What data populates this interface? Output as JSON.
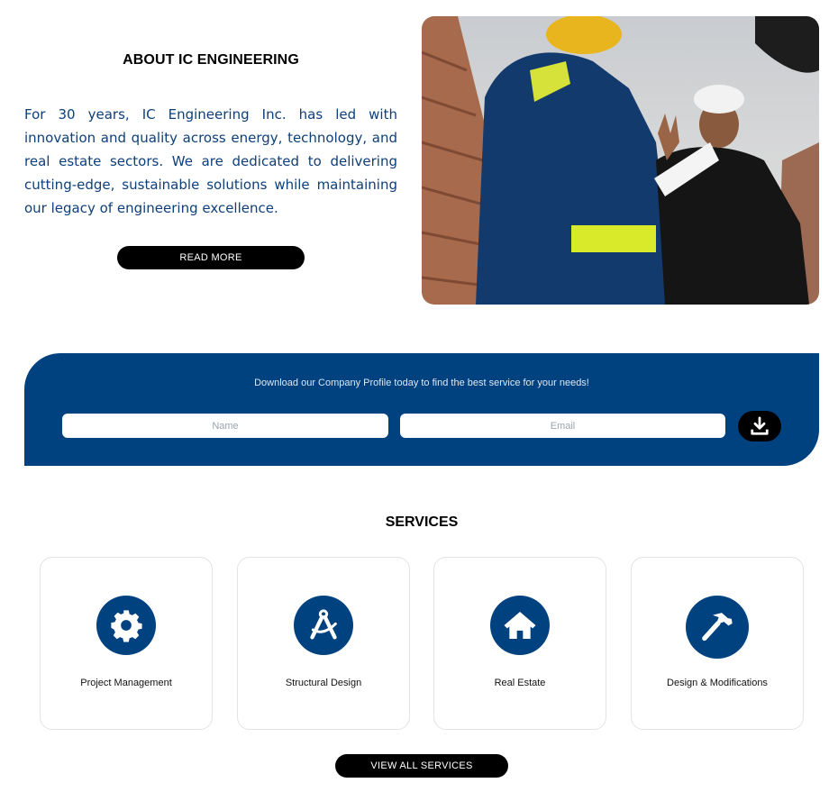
{
  "about": {
    "title": "ABOUT IC ENGINEERING",
    "body": "For 30 years, IC Engineering Inc. has led with innovation and quality across energy, technology, and real estate sectors. We are dedicated to delivering cutting-edge, sustainable solutions while maintaining our legacy of engineering excellence.",
    "read_more_label": "READ MORE"
  },
  "download": {
    "text": "Download our Company Profile today to find the best service for your needs!",
    "name_placeholder": "Name",
    "email_placeholder": "Email",
    "button_icon": "download-icon"
  },
  "services": {
    "title": "SERVICES",
    "items": [
      {
        "label": "Project Management",
        "icon": "gear-icon"
      },
      {
        "label": "Structural Design",
        "icon": "compass-icon"
      },
      {
        "label": "Real Estate",
        "icon": "house-icon"
      },
      {
        "label": "Design & Modifications",
        "icon": "hammer-icon"
      }
    ],
    "view_all_label": "VIEW ALL SERVICES"
  },
  "colors": {
    "brand_blue": "#00417f",
    "button_black": "#000000",
    "body_text_blue": "#0e3f7a"
  }
}
